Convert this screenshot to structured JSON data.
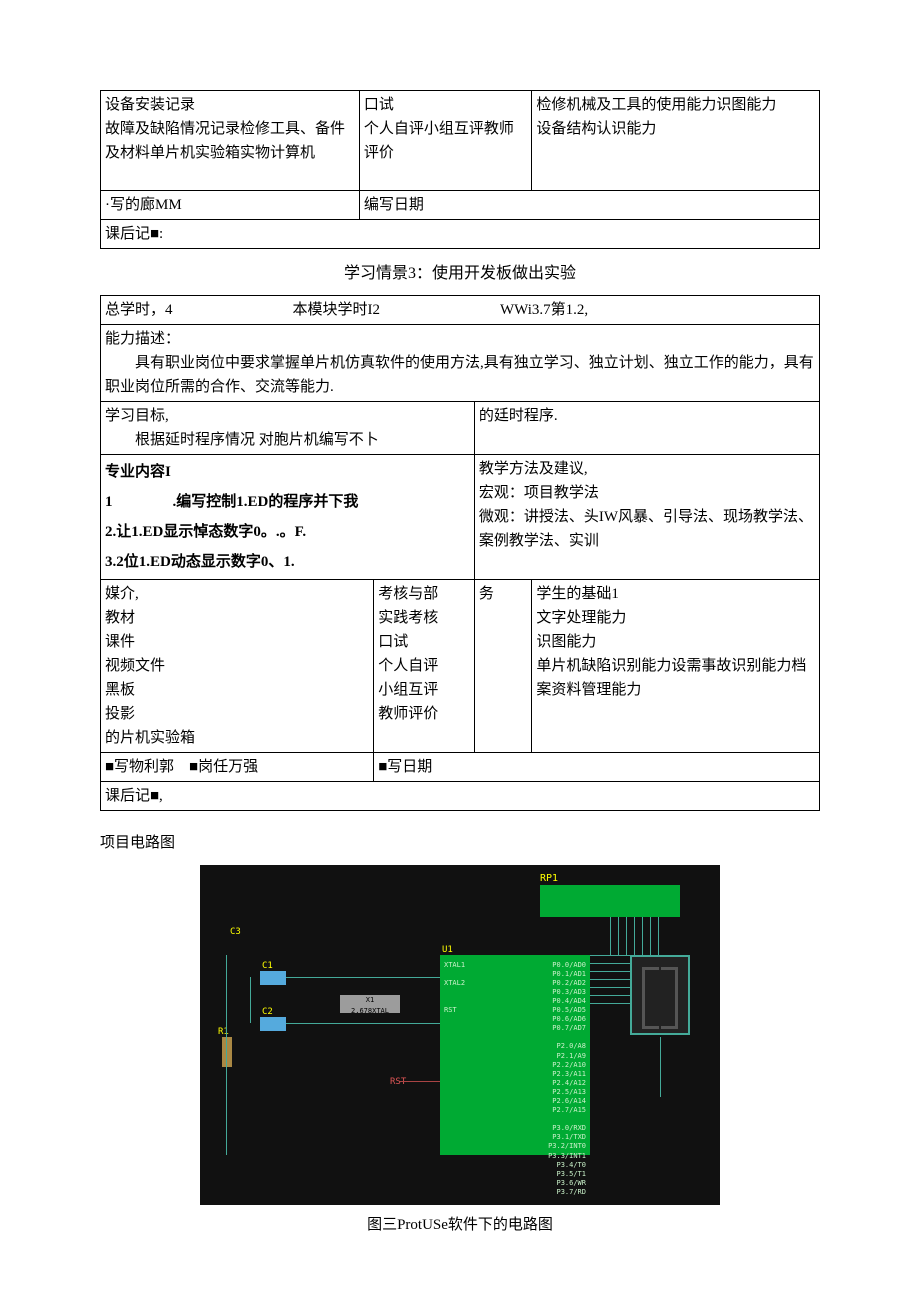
{
  "table1": {
    "r1c1": "设备安装记录\n故障及缺陷情况记录检修工具、备件及材料单片机实验箱实物计算机",
    "r1c2": "口试\n个人自评小组互评教师评价",
    "r1c3": "检修机械及工具的使用能力识图能力\n设备结构认识能力",
    "r2c1": "·写的廊MM",
    "r2c2": "编写日期",
    "r3c1": "课后记■:"
  },
  "section_title": "学习情景3：使用开发板做出实验",
  "table2": {
    "r1": "总学时，4　　　　　　　　本模块学时I2　　　　　　　　WWi3.7第1.2,",
    "r2": "能力描述：\n　　具有职业岗位中要求掌握单片机仿真软件的使用方法,具有独立学习、独立计划、独立工作的能力，具有职业岗位所需的合作、交流等能力.",
    "r3a": "学习目标,\n　　根据延时程序情况 对胞片机编写不卜",
    "r3b": "的廷时程序.",
    "r4a_title": "专业内容I",
    "r4a_1": "1　　　　.编写控制1.ED的程序并下我",
    "r4a_2": "2.让1.ED显示悼态数字0。.。F.",
    "r4a_3": "3.2位1.ED动态显示数字0、1.",
    "r4b": "教学方法及建议,\n宏观：项目教学法\n微观：讲授法、头IW风暴、引导法、现场教学法、案例教学法、实训",
    "r5a": "媒介,\n教材\n课件\n视频文件\n黑板\n投影\n的片机实验箱",
    "r5b": "考核与部\n实践考核\n口试\n个人自评\n小组互评\n教师评价",
    "r5c": "务",
    "r5d": "学生的基础1\n文字处理能力\n识图能力\n单片机缺陷识别能力设需事故识别能力档案资料管理能力",
    "r6a": "■写物利郭　■岗任万强",
    "r6b": "■写日期",
    "r7": "课后记■,"
  },
  "image_section_title": "项目电路图",
  "circuit": {
    "rp_label": "RP1",
    "chip_label": "U1",
    "c1": "C1",
    "c2": "C2",
    "c3": "C3",
    "r1": "R1",
    "x1": "X1",
    "x1_sub": "2.678XTAL",
    "rst": "RST",
    "left_pins": "XTAL1\n\nXTAL2\n\n\nRST\n\n\n\n\n\n\n\n\n\n\n\n\n\n\n\n\n\n",
    "right_pins": "P0.0/AD0\nP0.1/AD1\nP0.2/AD2\nP0.3/AD3\nP0.4/AD4\nP0.5/AD5\nP0.6/AD6\nP0.7/AD7\n\nP2.0/A8\nP2.1/A9\nP2.2/A10\nP2.3/A11\nP2.4/A12\nP2.5/A13\nP2.6/A14\nP2.7/A15\n\nP3.0/RXD\nP3.1/TXD\nP3.2/INT0\nP3.3/INT1\nP3.4/T0\nP3.5/T1\nP3.6/WR\nP3.7/RD"
  },
  "caption": "图三ProtUSe软件下的电路图"
}
